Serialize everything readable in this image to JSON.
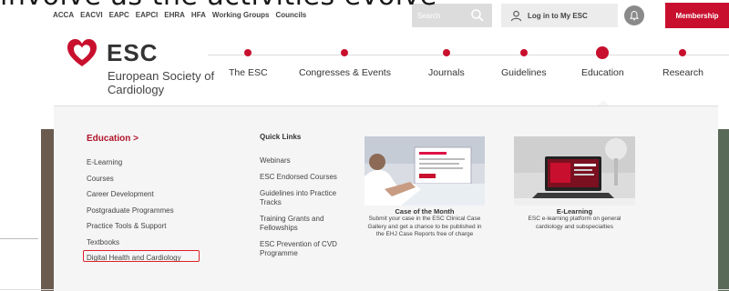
{
  "overlay": {
    "caption": "involve as the activities evolve"
  },
  "topbar": {
    "links": [
      "ACCA",
      "EACVI",
      "EAPC",
      "EAPCI",
      "EHRA",
      "HFA",
      "Working Groups",
      "Councils"
    ],
    "search_placeholder": "Search",
    "login_label": "Log in to My ESC",
    "membership_label": "Membership"
  },
  "brand": {
    "title": "ESC",
    "subtitle": "European Society of Cardiology"
  },
  "nav": {
    "items": [
      {
        "label": "The ESC"
      },
      {
        "label": "Congresses & Events"
      },
      {
        "label": "Journals"
      },
      {
        "label": "Guidelines"
      },
      {
        "label": "Education",
        "active": true
      },
      {
        "label": "Research"
      }
    ]
  },
  "mega_menu": {
    "education_title": "Education >",
    "education_links": [
      "E-Learning",
      "Courses",
      "Career Development",
      "Postgraduate Programmes",
      "Practice Tools & Support",
      "Textbooks",
      "Digital Health and Cardiology"
    ],
    "quick_links_title": "Quick Links",
    "quick_links": [
      "Webinars",
      "ESC Endorsed Courses",
      "Guidelines into Practice Tracks",
      "Training Grants and Fellowships",
      "ESC Prevention of CVD Programme"
    ],
    "cards": [
      {
        "title": "Case of the Month",
        "description": "Submit your case in the ESC Clinical Case Gallery and get a chance to be published in the EHJ Case Reports free of charge"
      },
      {
        "title": "E-Learning",
        "description": "ESC e-learning platform on general cardiology and subspecialties"
      }
    ]
  },
  "colors": {
    "brand_red": "#c8102e",
    "highlight_border": "#e0202a",
    "menu_bg": "#f5f5f5"
  }
}
